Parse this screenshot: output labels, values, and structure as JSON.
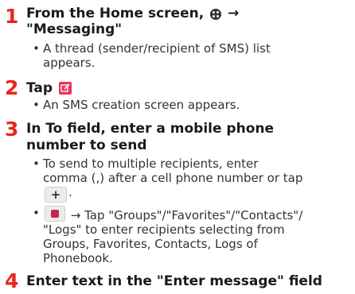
{
  "steps": [
    {
      "number": "1",
      "heading_line1_prefix": "From the Home screen,",
      "heading_line1_suffix": "→",
      "heading_line2": "\"Messaging\"",
      "bullet_line1": "A thread (sender/recipient of SMS) list",
      "bullet_line2": "appears."
    },
    {
      "number": "2",
      "heading": "Tap",
      "bullet": "An SMS creation screen appears."
    },
    {
      "number": "3",
      "heading_line1": "In To field, enter a mobile phone",
      "heading_line2": "number to send",
      "bullet1_line1": "To send to multiple recipients, enter",
      "bullet1_line2": "comma (,) after a cell phone number or tap",
      "bullet1_line3_suffix": ".",
      "plus_key": "+",
      "bullet2_line1": "→ Tap \"Groups\"/\"Favorites\"/\"Contacts\"/",
      "bullet2_line2": "\"Logs\" to enter recipients selecting from",
      "bullet2_line3": "Groups, Favorites, Contacts, Logs of",
      "bullet2_line4": "Phonebook."
    },
    {
      "number": "4",
      "heading": "Enter text in the \"Enter message\" field"
    }
  ],
  "bullet_symbol": "•",
  "colors": {
    "step_number": "#e8261c",
    "compose_icon": "#e6355f",
    "contact_icon": "#c0294a"
  }
}
